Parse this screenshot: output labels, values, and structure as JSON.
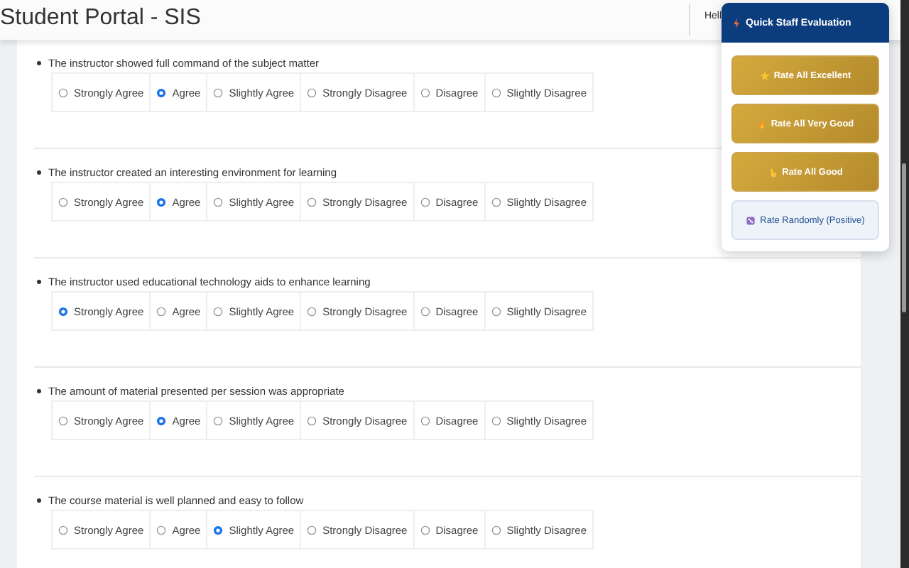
{
  "header": {
    "title": "Student Portal - SIS",
    "greeting": "Hell"
  },
  "questions": [
    {
      "text": "The instructor showed full command of the subject matter",
      "options": [
        {
          "label": "Strongly Agree",
          "selected": false
        },
        {
          "label": "Agree",
          "selected": true
        },
        {
          "label": "Slightly Agree",
          "selected": false
        },
        {
          "label": "Strongly Disagree",
          "selected": false
        },
        {
          "label": "Disagree",
          "selected": false
        },
        {
          "label": "Slightly Disagree",
          "selected": false
        }
      ]
    },
    {
      "text": "The instructor created an interesting environment for learning",
      "options": [
        {
          "label": "Strongly Agree",
          "selected": false
        },
        {
          "label": "Agree",
          "selected": true
        },
        {
          "label": "Slightly Agree",
          "selected": false
        },
        {
          "label": "Strongly Disagree",
          "selected": false
        },
        {
          "label": "Disagree",
          "selected": false
        },
        {
          "label": "Slightly Disagree",
          "selected": false
        }
      ]
    },
    {
      "text": "The instructor used educational technology aids to enhance learning",
      "options": [
        {
          "label": "Strongly Agree",
          "selected": true
        },
        {
          "label": "Agree",
          "selected": false
        },
        {
          "label": "Slightly Agree",
          "selected": false
        },
        {
          "label": "Strongly Disagree",
          "selected": false
        },
        {
          "label": "Disagree",
          "selected": false
        },
        {
          "label": "Slightly Disagree",
          "selected": false
        }
      ]
    },
    {
      "text": "The amount of material presented per session was appropriate",
      "options": [
        {
          "label": "Strongly Agree",
          "selected": false
        },
        {
          "label": "Agree",
          "selected": true
        },
        {
          "label": "Slightly Agree",
          "selected": false
        },
        {
          "label": "Strongly Disagree",
          "selected": false
        },
        {
          "label": "Disagree",
          "selected": false
        },
        {
          "label": "Slightly Disagree",
          "selected": false
        }
      ]
    },
    {
      "text": "The course material is well planned and easy to follow",
      "options": [
        {
          "label": "Strongly Agree",
          "selected": false
        },
        {
          "label": "Agree",
          "selected": false
        },
        {
          "label": "Slightly Agree",
          "selected": true
        },
        {
          "label": "Strongly Disagree",
          "selected": false
        },
        {
          "label": "Disagree",
          "selected": false
        },
        {
          "label": "Slightly Disagree",
          "selected": false
        }
      ]
    }
  ],
  "panel": {
    "title": "Quick Staff Evaluation",
    "buttons": [
      {
        "label": "Rate All Excellent",
        "kind": "gold"
      },
      {
        "label": "Rate All Very Good",
        "kind": "gold"
      },
      {
        "label": "Rate All Good",
        "kind": "gold"
      },
      {
        "label": "Rate Randomly (Positive)",
        "kind": "light"
      }
    ]
  }
}
